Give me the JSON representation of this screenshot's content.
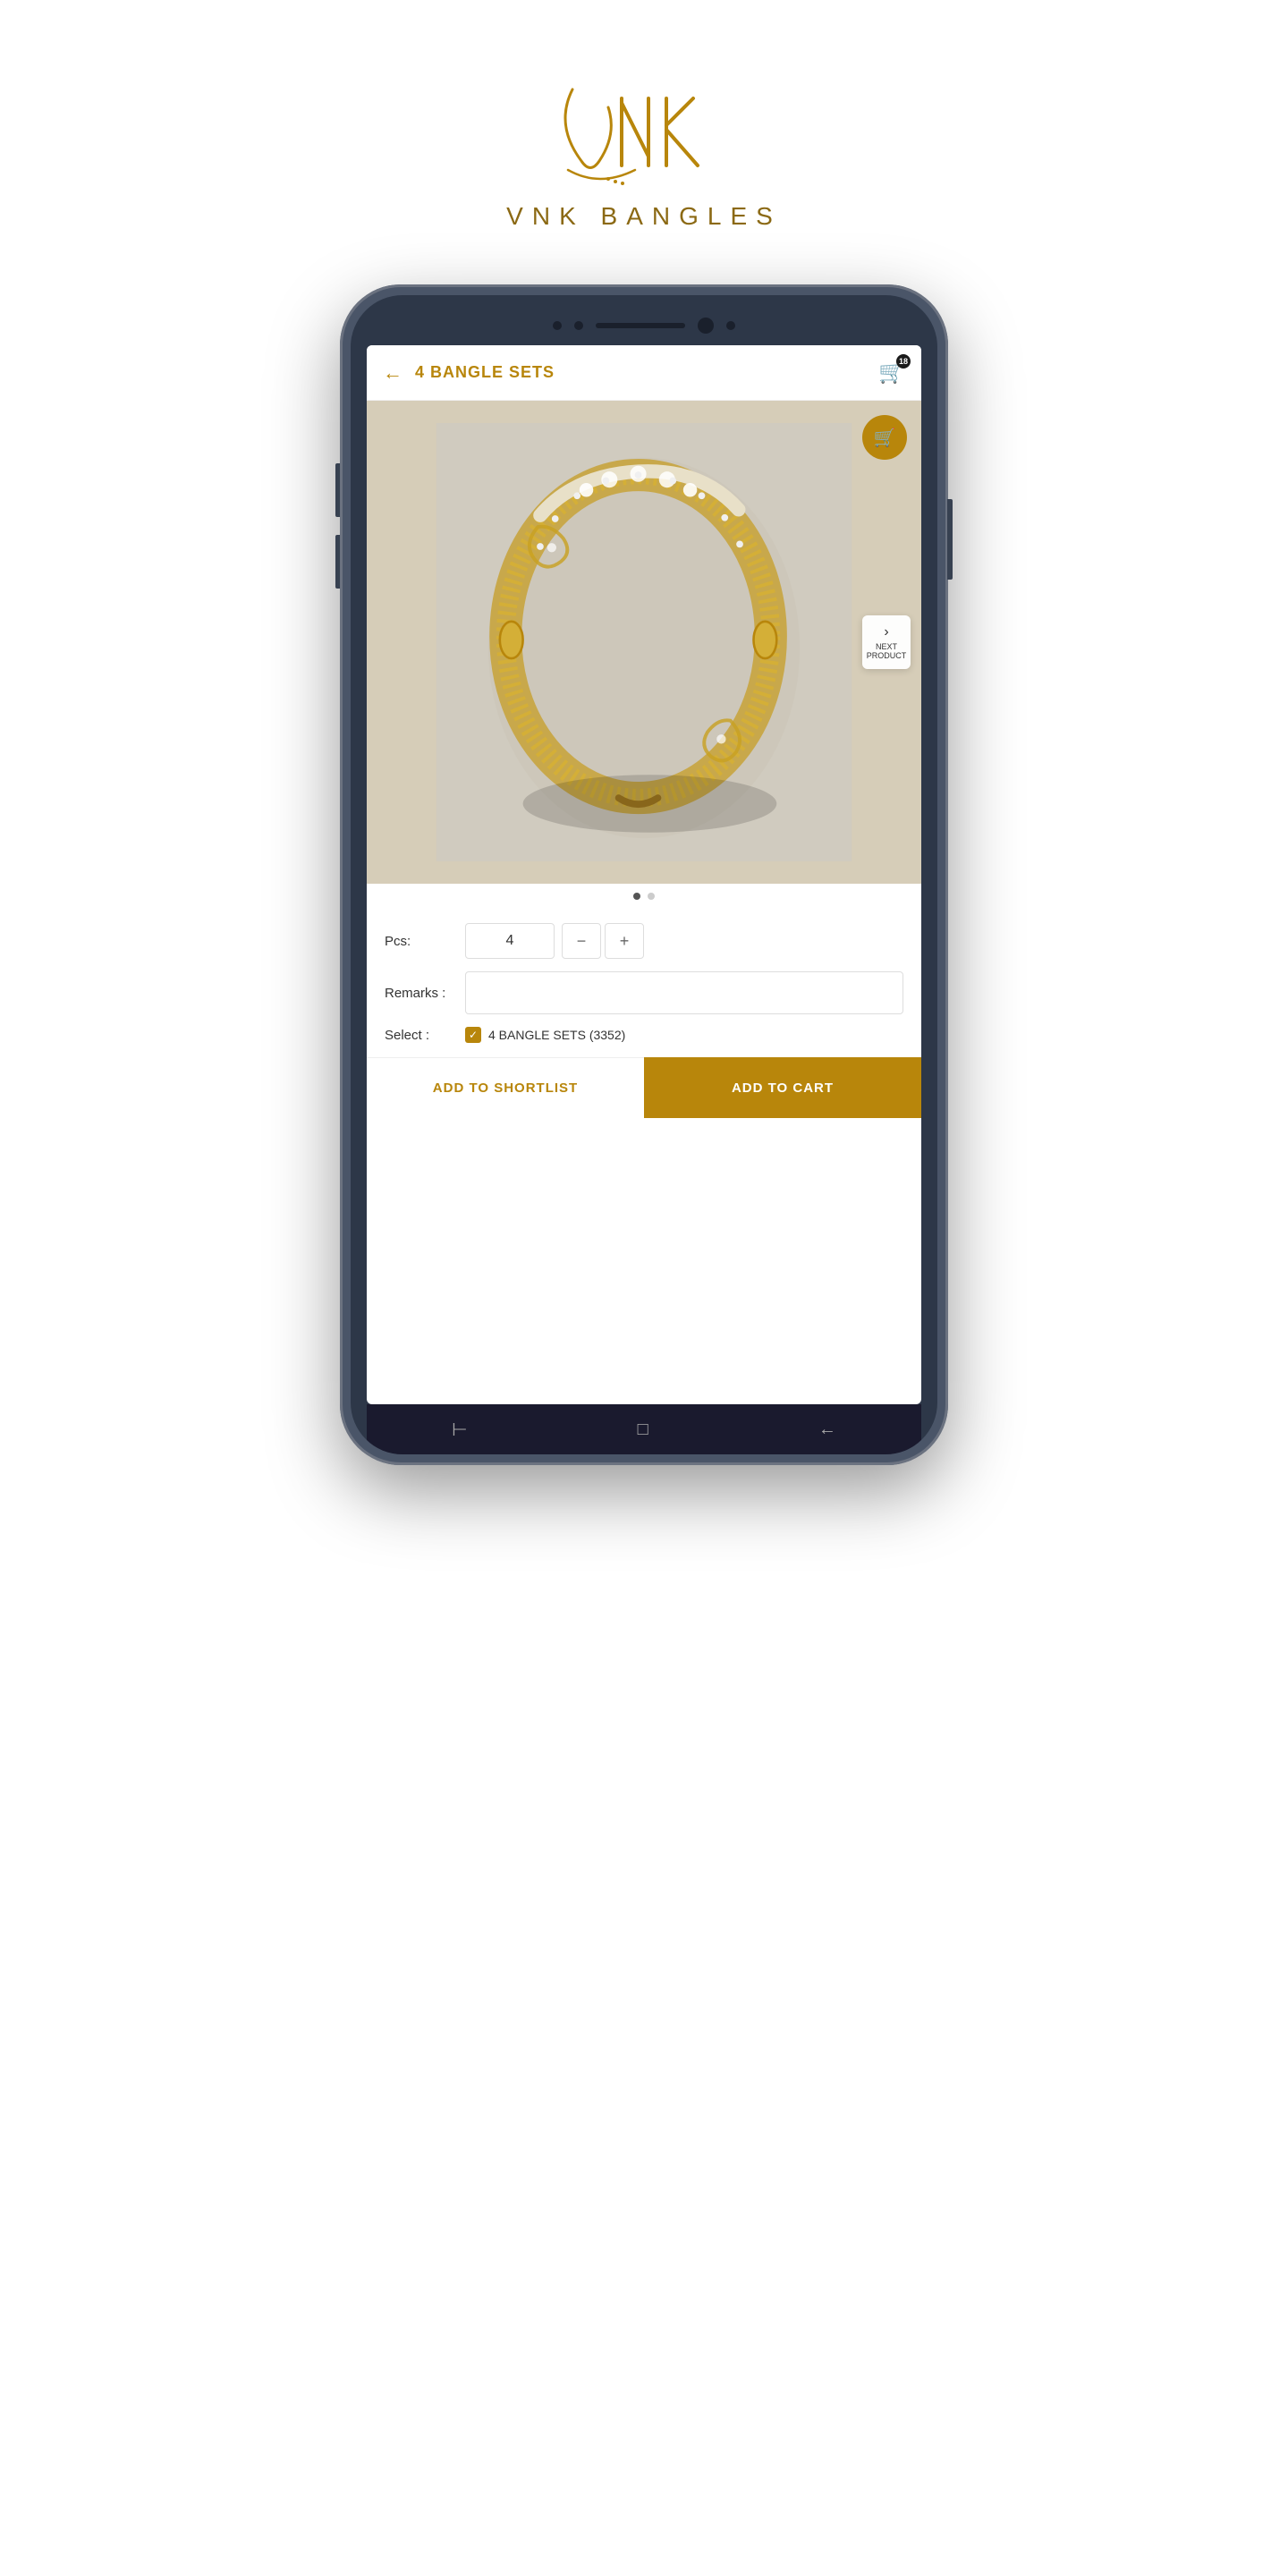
{
  "brand": {
    "name": "VNK BANGLES",
    "tagline": ""
  },
  "header": {
    "title": "4 BANGLE SETS",
    "back_label": "←",
    "cart_count": "18"
  },
  "product": {
    "name": "4 BANGLE SETS",
    "image_alt": "Gold bangle set with diamond pattern",
    "dots": [
      true,
      false
    ],
    "overlay_cart_icon": "🛒"
  },
  "next_product": {
    "label_line1": "NEXT",
    "label_line2": "PRODUCT",
    "chevron": "›"
  },
  "form": {
    "pcs_label": "Pcs:",
    "pcs_value": "4",
    "remarks_label": "Remarks :",
    "remarks_placeholder": "",
    "select_label": "Select :",
    "select_item_label": "4 BANGLE SETS (3352)",
    "qty_minus": "−",
    "qty_plus": "+"
  },
  "buttons": {
    "shortlist": "ADD TO SHORTLIST",
    "add_cart": "ADD TO CART"
  },
  "colors": {
    "gold": "#b8860b",
    "gold_dark": "#8B6914"
  }
}
